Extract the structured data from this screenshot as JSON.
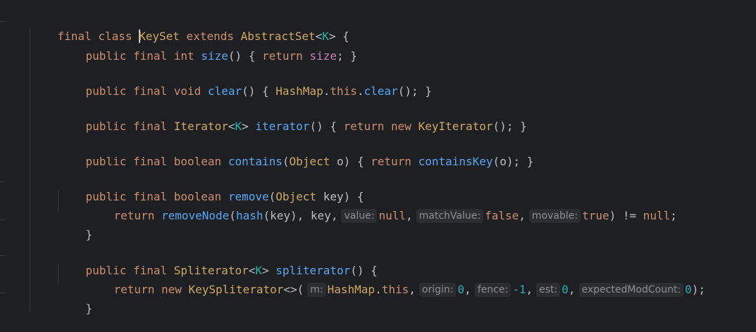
{
  "colors": {
    "background": "#1e1f22",
    "keyword": "#cf8e6d",
    "class_name": "#c77dbb",
    "type": "#cfa861",
    "type_param": "#16baac",
    "method": "#56a8f5",
    "field": "#c77dbb",
    "number": "#2aacb8",
    "hint_bg": "#2b2d30",
    "hint_fg": "#8c8f97",
    "default": "#bcbec4"
  },
  "code": {
    "l1": {
      "kw1": "final ",
      "kw2": "class ",
      "name": "KeySet",
      "kw3": " extends ",
      "super": "AbstractSet",
      "lt": "<",
      "tp": "K",
      "rest": "> {"
    },
    "l2": {
      "kw": "public final int ",
      "fn": "size",
      "p1": "() { ",
      "ret": "return ",
      "field": "size",
      "p2": "; }"
    },
    "l3": {
      "kw": "public final void ",
      "fn": "clear",
      "p1": "() { ",
      "cls": "HashMap",
      "dot": ".",
      "this": "this",
      "dot2": ".",
      "fn2": "clear",
      "p2": "(); }"
    },
    "l4": {
      "kw": "public final ",
      "type": "Iterator",
      "lt": "<",
      "tp": "K",
      "gt": "> ",
      "fn": "iterator",
      "p1": "() { ",
      "ret": "return new ",
      "cls": "KeyIterator",
      "p2": "(); }"
    },
    "l5": {
      "kw": "public final boolean ",
      "fn": "contains",
      "p1": "(",
      "type": "Object",
      "sp": " ",
      "param": "o",
      "p2": ") { ",
      "ret": "return ",
      "fn2": "containsKey",
      "p3": "(",
      "param2": "o",
      "p4": "); }"
    },
    "l6": {
      "kw": "public final boolean ",
      "fn": "remove",
      "p1": "(",
      "type": "Object",
      "sp": " ",
      "param": "key",
      "p2": ") {"
    },
    "l7": {
      "ret": "return ",
      "fn": "removeNode",
      "p1": "(",
      "fn2": "hash",
      "p2": "(",
      "param": "key",
      "p3": "), ",
      "param2": "key",
      "p4": ",",
      "hint1": "value:",
      "v1": "null",
      "c1": ",",
      "hint2": "matchValue:",
      "v2": "false",
      "c2": ",",
      "hint3": "movable:",
      "v3": "true",
      "p5": ") != ",
      "v4": "null",
      "p6": ";"
    },
    "l8": {
      "brace": "}"
    },
    "l9": {
      "kw": "public final ",
      "type": "Spliterator",
      "lt": "<",
      "tp": "K",
      "gt": "> ",
      "fn": "spliterator",
      "p1": "() {"
    },
    "l10": {
      "ret": "return new ",
      "cls": "KeySpliterator",
      "p1": "<>(",
      "hint1": "m:",
      "cls2": "HashMap",
      "dot": ".",
      "this": "this",
      "c1": ",",
      "hint2": "origin:",
      "v1": "0",
      "c2": ",",
      "hint3": "fence:",
      "v2": "-1",
      "c3": ",",
      "hint4": "est:",
      "v3": "0",
      "c4": ",",
      "hint5": "expectedModCount:",
      "v4": "0",
      "p2": ");"
    },
    "l11": {
      "brace": "}"
    }
  }
}
